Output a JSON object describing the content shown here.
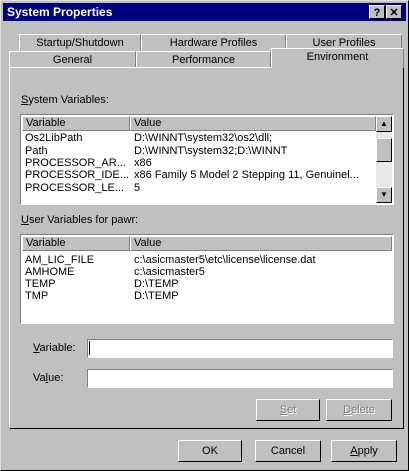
{
  "window": {
    "title": "System Properties",
    "help": "?",
    "close": "✕"
  },
  "tabs": {
    "back": [
      "Startup/Shutdown",
      "Hardware Profiles",
      "User Profiles"
    ],
    "front": [
      "General",
      "Performance",
      "Environment"
    ],
    "active": "Environment"
  },
  "system_vars": {
    "label": "System Variables:",
    "col_variable": "Variable",
    "col_value": "Value",
    "rows": [
      {
        "variable": "Os2LibPath",
        "value": "D:\\WINNT\\system32\\os2\\dll;"
      },
      {
        "variable": "Path",
        "value": "D:\\WINNT\\system32;D:\\WINNT"
      },
      {
        "variable": "PROCESSOR_AR...",
        "value": "x86"
      },
      {
        "variable": "PROCESSOR_IDE...",
        "value": "x86 Family 5 Model 2 Stepping 11, Genuinel..."
      },
      {
        "variable": "PROCESSOR_LE...",
        "value": "5"
      }
    ]
  },
  "user_vars": {
    "label": "User Variables for pawr:",
    "col_variable": "Variable",
    "col_value": "Value",
    "rows": [
      {
        "variable": "AM_LIC_FILE",
        "value": "c:\\asicmaster5\\etc\\license\\license.dat"
      },
      {
        "variable": "AMHOME",
        "value": "c:\\asicmaster5"
      },
      {
        "variable": "TEMP",
        "value": "D:\\TEMP"
      },
      {
        "variable": "TMP",
        "value": "D:\\TEMP"
      }
    ]
  },
  "editor": {
    "variable_label": "Variable:",
    "variable_value": "",
    "value_label": "Value:",
    "value_value": "",
    "set_label": "Set",
    "delete_label": "Delete"
  },
  "footer": {
    "ok": "OK",
    "cancel": "Cancel",
    "apply": "Apply"
  },
  "colors": {
    "face": "#c0c0c0",
    "title_bar": "#000080",
    "disabled_text": "#808080"
  }
}
